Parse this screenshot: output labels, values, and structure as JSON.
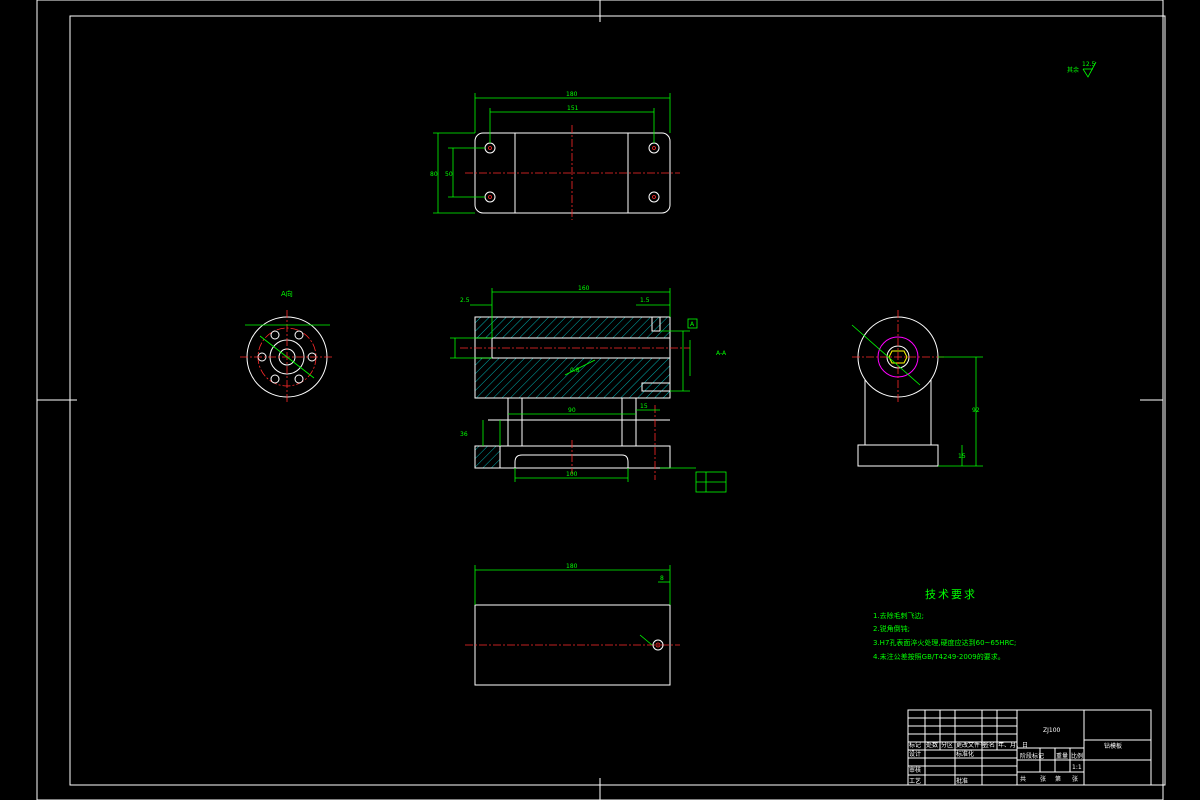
{
  "tech_requirements": {
    "title": "技术要求",
    "items": [
      "1.去除毛刺飞边;",
      "2.锐角倒钝;",
      "3.H7孔表面淬火处理,硬度应达到60~65HRC;",
      "4.未注公差按照GB/T4249-2009的要求。"
    ]
  },
  "roughness_note": "其余",
  "roughness_value": "12.5",
  "section_label": "A-A",
  "view_label": "A向",
  "dimensions": {
    "top_overall_length": "180",
    "top_hole_spacing": "151",
    "top_height": "80",
    "top_hole_vertical": "50",
    "main_length": "160",
    "main_left_offset": "2.5",
    "main_right_small": "1.5",
    "bore_note": "0.8",
    "base_span": "90",
    "base_inner": "15",
    "base_step": "36",
    "bottom_slot": "100",
    "right_height": "92",
    "right_base": "15",
    "bottom_length": "180",
    "bottom_offset": "8",
    "datum": "A"
  },
  "title_block": {
    "part_name": "钻模板",
    "drawing_no": "ZJ100",
    "row_labels": [
      "标记",
      "处数",
      "分区",
      "更改文件号",
      "签名",
      "年、月、日"
    ],
    "role_labels": [
      "设计",
      "审核",
      "工艺",
      "标准化",
      "批准"
    ],
    "stage_labels": [
      "阶段标记",
      "重量",
      "比例"
    ],
    "scale": "1:1",
    "sheet_labels": [
      "共",
      "张",
      "第",
      "张"
    ]
  }
}
